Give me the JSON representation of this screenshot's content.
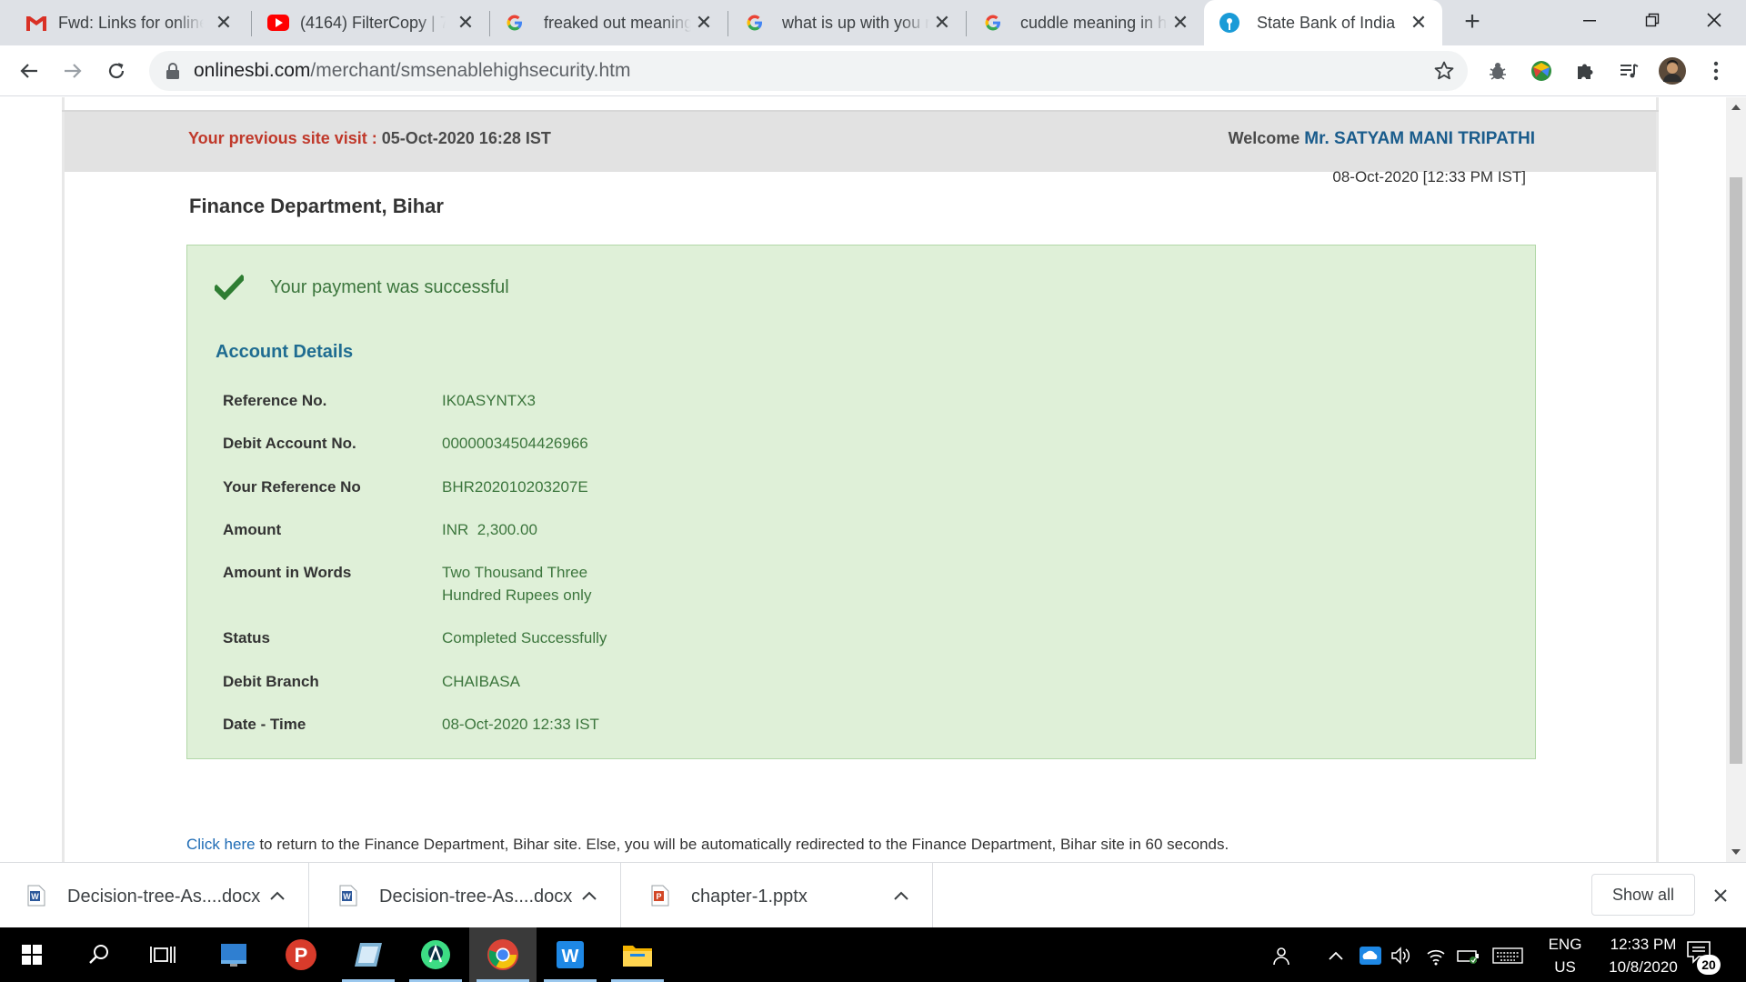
{
  "browser": {
    "tabs": [
      {
        "title": "Fwd: Links for online",
        "icon": "gmail-icon"
      },
      {
        "title": "(4164) FilterCopy | 7",
        "icon": "youtube-icon"
      },
      {
        "title": "freaked out meaning",
        "icon": "google-icon"
      },
      {
        "title": "what is up with you r",
        "icon": "google-icon"
      },
      {
        "title": "cuddle meaning in h",
        "icon": "google-icon"
      },
      {
        "title": "State Bank of India",
        "icon": "sbi-icon",
        "active": true
      }
    ],
    "url_domain": "onlinesbi.com",
    "url_path": "/merchant/smsenablehighsecurity.htm"
  },
  "page": {
    "prev_visit_label": "Your previous site visit :",
    "prev_visit_value": "05-Oct-2020 16:28 IST",
    "welcome_label": "Welcome",
    "welcome_name": "Mr. SATYAM MANI TRIPATHI",
    "current_datetime": "08-Oct-2020 [12:33 PM IST]",
    "dept_title": "Finance Department, Bihar",
    "success_message": "Your payment was successful",
    "account_heading": "Account Details",
    "details": [
      {
        "label": "Reference No.",
        "value": "IK0ASYNTX3"
      },
      {
        "label": "Debit Account No.",
        "value": "00000034504426966"
      },
      {
        "label": "Your Reference No",
        "value": "BHR202010203207E"
      },
      {
        "label": "Amount",
        "value": "INR  2,300.00"
      },
      {
        "label": "Amount in Words",
        "value": "Two Thousand Three Hundred Rupees only"
      },
      {
        "label": "Status",
        "value": "Completed Successfully"
      },
      {
        "label": "Debit Branch",
        "value": "CHAIBASA"
      },
      {
        "label": "Date - Time",
        "value": "08-Oct-2020 12:33 IST"
      }
    ],
    "click_here": "Click here",
    "redirect_text": " to return to the Finance Department, Bihar site. Else, you will be automatically redirected to the Finance Department, Bihar site in 60 seconds."
  },
  "downloads": {
    "items": [
      {
        "name": "Decision-tree-As....docx",
        "type": "docx"
      },
      {
        "name": "Decision-tree-As....docx",
        "type": "docx"
      },
      {
        "name": "chapter-1.pptx",
        "type": "pptx"
      }
    ],
    "show_all": "Show all"
  },
  "taskbar": {
    "lang_line1": "ENG",
    "lang_line2": "US",
    "time": "12:33 PM",
    "date": "10/8/2020",
    "notifications": "20"
  },
  "colors": {
    "success_bg": "#dff0d8",
    "success_text": "#3c763d",
    "heading_blue": "#1f6c91",
    "prev_visit_red": "#c0392b"
  }
}
